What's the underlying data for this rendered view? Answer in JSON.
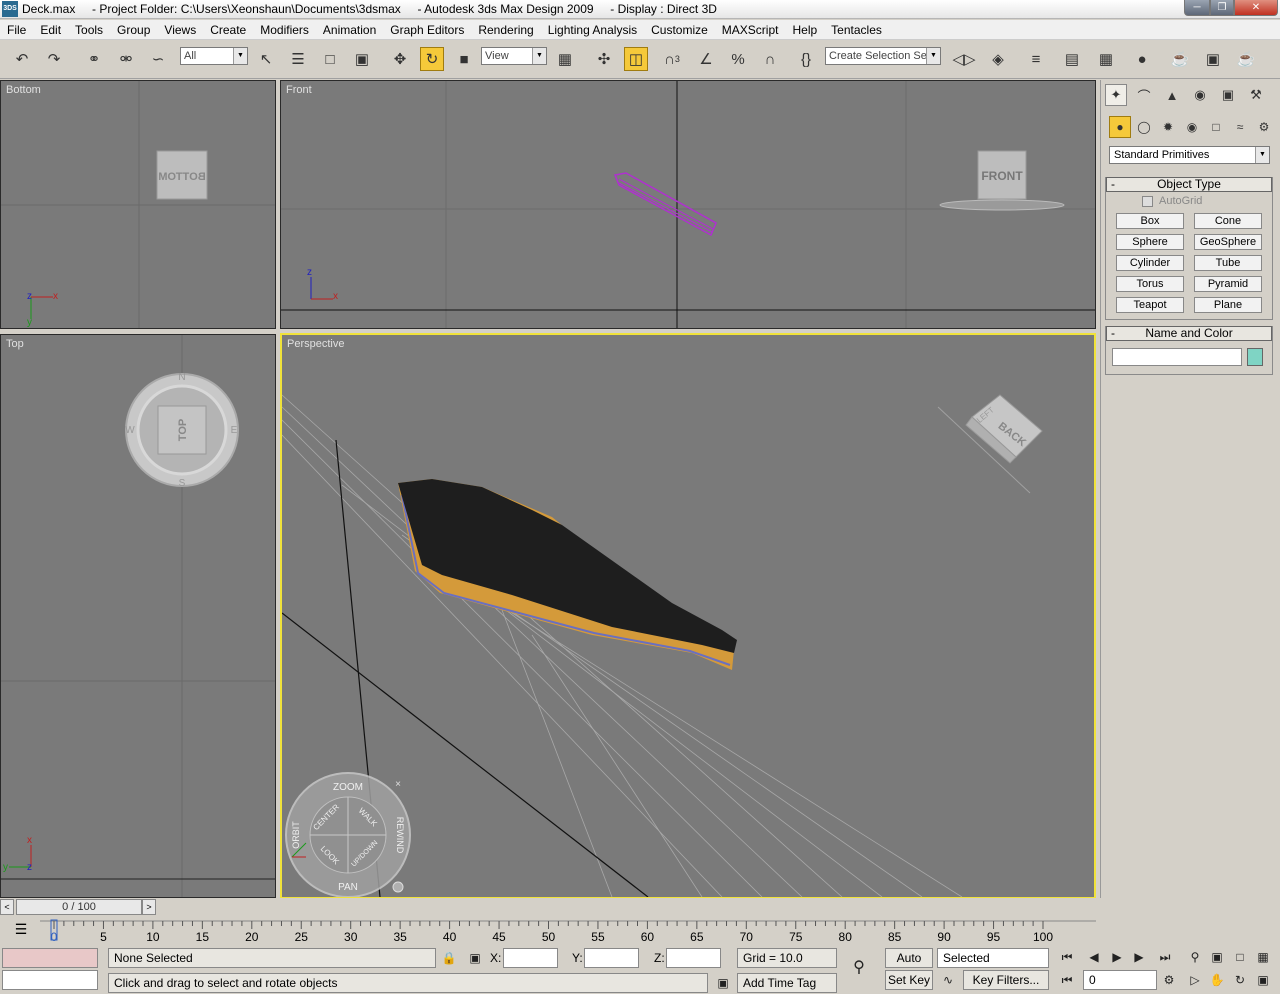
{
  "window": {
    "title": "Deck.max     - Project Folder: C:\\Users\\Xeonshaun\\Documents\\3dsmax     - Autodesk 3ds Max Design 2009     - Display : Direct 3D",
    "app_icon": "3DS"
  },
  "menu": [
    "File",
    "Edit",
    "Tools",
    "Group",
    "Views",
    "Create",
    "Modifiers",
    "Animation",
    "Graph Editors",
    "Rendering",
    "Lighting Analysis",
    "Customize",
    "MAXScript",
    "Help",
    "Tentacles"
  ],
  "toolbar": {
    "selection_filter": "All",
    "ref_coord": "View",
    "named_selection": "Create Selection Set",
    "snap_label": "3"
  },
  "viewports": {
    "bottom": {
      "label": "Bottom",
      "cube": "BOTTOM"
    },
    "front": {
      "label": "Front",
      "cube": "FRONT"
    },
    "top": {
      "label": "Top",
      "cube": "TOP"
    },
    "perspective": {
      "label": "Perspective",
      "cube": "BACK",
      "cube_side": "LEFT"
    },
    "axis": {
      "x": "x",
      "y": "y",
      "z": "z"
    },
    "compass": {
      "n": "N",
      "s": "S",
      "e": "E",
      "w": "W"
    },
    "steering_wheel": {
      "zoom": "ZOOM",
      "orbit": "ORBIT",
      "center": "CENTER",
      "walk": "WALK",
      "rewind": "REWIND",
      "look": "LOOK",
      "updown": "UP/DOWN",
      "pan": "PAN"
    }
  },
  "command_panel": {
    "category": "Standard Primitives",
    "object_type": {
      "title": "Object Type",
      "autogrid": "AutoGrid",
      "buttons": [
        "Box",
        "Cone",
        "Sphere",
        "GeoSphere",
        "Cylinder",
        "Tube",
        "Torus",
        "Pyramid",
        "Teapot",
        "Plane"
      ]
    },
    "name_and_color": {
      "title": "Name and Color",
      "name_value": "",
      "color": "#7fd4c4"
    }
  },
  "timeline": {
    "slider": "0 / 100",
    "ticks": [
      "0",
      "5",
      "10",
      "15",
      "20",
      "25",
      "30",
      "35",
      "40",
      "45",
      "50",
      "55",
      "60",
      "65",
      "70",
      "75",
      "80",
      "85",
      "90",
      "95",
      "100"
    ]
  },
  "status": {
    "selection": "None Selected",
    "prompt": "Click and drag to select and rotate objects",
    "x_label": "X:",
    "y_label": "Y:",
    "z_label": "Z:",
    "grid": "Grid = 10.0",
    "add_time_tag": "Add Time Tag",
    "auto_key": "Auto Key",
    "set_key": "Set Key",
    "key_mode": "Selected",
    "key_filters": "Key Filters...",
    "frame": "0"
  }
}
